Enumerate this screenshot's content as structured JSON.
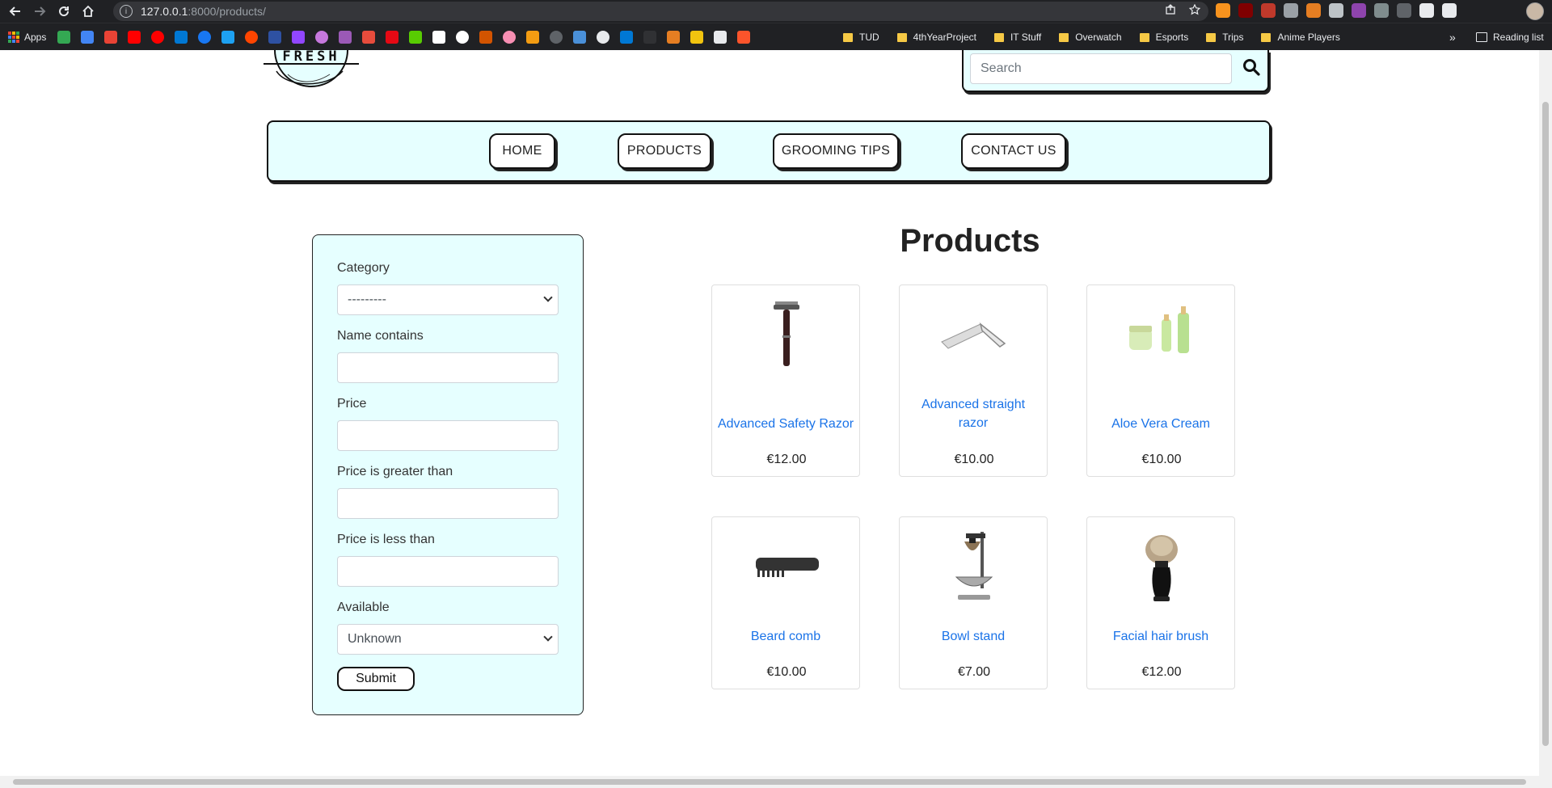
{
  "browser": {
    "url_host": "127.0.0.1",
    "url_path": ":8000/products/",
    "bookmarks": {
      "apps_label": "Apps",
      "folders": [
        "TUD",
        "4thYearProject",
        "IT Stuff",
        "Overwatch",
        "Esports",
        "Trips",
        "Anime Players"
      ],
      "more": "»",
      "reading_list": "Reading list"
    }
  },
  "header": {
    "logo_text": "FRESH",
    "search_placeholder": "Search"
  },
  "nav": {
    "items": [
      "HOME",
      "PRODUCTS",
      "GROOMING TIPS",
      "CONTACT US"
    ]
  },
  "filter": {
    "category_label": "Category",
    "category_value": "---------",
    "name_label": "Name contains",
    "price_label": "Price",
    "price_gt_label": "Price is greater than",
    "price_lt_label": "Price is less than",
    "available_label": "Available",
    "available_value": "Unknown",
    "submit_label": "Submit"
  },
  "main": {
    "title": "Products",
    "products": [
      {
        "name_line1": "Advanced Safety Razor",
        "name_line2": "",
        "price": "€12.00",
        "icon": "safety-razor"
      },
      {
        "name_line1": "Advanced straight",
        "name_line2": "razor",
        "price": "€10.00",
        "icon": "straight-razor"
      },
      {
        "name_line1": "Aloe Vera Cream",
        "name_line2": "",
        "price": "€10.00",
        "icon": "aloe-cream"
      },
      {
        "name_line1": "Beard comb",
        "name_line2": "",
        "price": "€10.00",
        "icon": "beard-comb"
      },
      {
        "name_line1": "Bowl stand",
        "name_line2": "",
        "price": "€7.00",
        "icon": "bowl-stand"
      },
      {
        "name_line1": "Facial hair brush",
        "name_line2": "",
        "price": "€12.00",
        "icon": "facial-hair-brush"
      }
    ]
  },
  "colors": {
    "accent_bg": "#e6ffff",
    "link": "#1a73e8"
  }
}
